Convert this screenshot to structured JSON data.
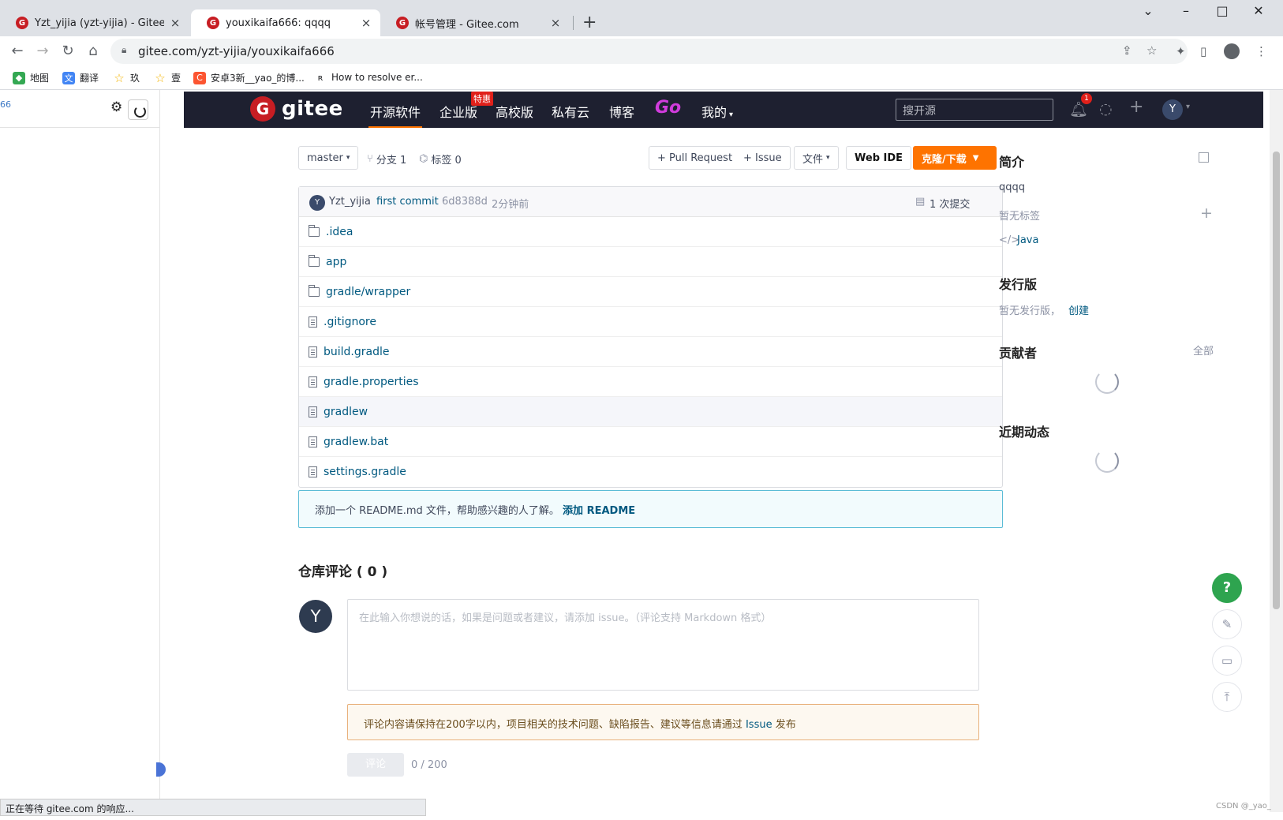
{
  "browser": {
    "tabs": [
      {
        "title": "Yzt_yijia (yzt-yijia) - Gitee.com",
        "active": false
      },
      {
        "title": "youxikaifa666: qqqq",
        "active": true
      },
      {
        "title": "帐号管理 - Gitee.com",
        "active": false
      }
    ],
    "url": "gitee.com/yzt-yijia/youxikaifa666",
    "bookmarks": [
      {
        "label": "地图",
        "icon": "maps-icon"
      },
      {
        "label": "翻译",
        "icon": "translate-icon"
      },
      {
        "label": "玖",
        "icon": "star-icon"
      },
      {
        "label": "壹",
        "icon": "star-icon"
      },
      {
        "label": "安卓3新__yao_的博...",
        "icon": "csdn-icon"
      },
      {
        "label": "How to resolve er...",
        "icon": "bookmark-icon"
      }
    ],
    "status_text": "正在等待 gitee.com 的响应..."
  },
  "left_panel": {
    "counter_text": "66"
  },
  "gitee_nav": {
    "logo_text": "gitee",
    "links": [
      "开源软件",
      "企业版",
      "高校版",
      "私有云",
      "博客"
    ],
    "enterprise_badge": "特惠",
    "go_label": "Go",
    "mine_label": "我的",
    "search_placeholder": "搜开源",
    "notification_count": "1",
    "user_initial": "Y"
  },
  "repo_toolbar": {
    "branch": "master",
    "branches_label": "分支 1",
    "tags_label": "标签 0",
    "pull_request_label": "+ Pull Request",
    "issue_label": "+ Issue",
    "file_label": "文件",
    "webide_label": "Web IDE",
    "clone_label": "克隆/下载"
  },
  "commit": {
    "author_initial": "Y",
    "author": "Yzt_yijia",
    "message": "first commit",
    "hash": "6d8388d",
    "time": "2分钟前",
    "commits_label": "1 次提交"
  },
  "files": [
    {
      "name": ".idea",
      "type": "folder"
    },
    {
      "name": "app",
      "type": "folder"
    },
    {
      "name": "gradle/wrapper",
      "type": "folder"
    },
    {
      "name": ".gitignore",
      "type": "file"
    },
    {
      "name": "build.gradle",
      "type": "file"
    },
    {
      "name": "gradle.properties",
      "type": "file"
    },
    {
      "name": "gradlew",
      "type": "file"
    },
    {
      "name": "gradlew.bat",
      "type": "file"
    },
    {
      "name": "settings.gradle",
      "type": "file"
    }
  ],
  "readme_tip": {
    "text": "添加一个 README.md 文件，帮助感兴趣的人了解。",
    "link": "添加 README"
  },
  "comments": {
    "title": "仓库评论 ( 0 )",
    "avatar_initial": "Y",
    "placeholder": "在此输入你想说的话，如果是问题或者建议，请添加 issue。（评论支持 Markdown 格式）",
    "tip_text": "评论内容请保持在200字以内，项目相关的技术问题、缺陷报告、建议等信息请通过",
    "tip_link": "Issue",
    "tip_end": "发布",
    "submit_label": "评论",
    "counter": "0 / 200"
  },
  "sidebar": {
    "intro_title": "简介",
    "description": "qqqq",
    "no_tags": "暂无标签",
    "language": "Java",
    "releases_title": "发行版",
    "no_release": "暂无发行版，",
    "create_link": "创建",
    "contributors_title": "贡献者",
    "all_link": "全部",
    "activity_title": "近期动态"
  },
  "watermark": "CSDN @_yao_"
}
